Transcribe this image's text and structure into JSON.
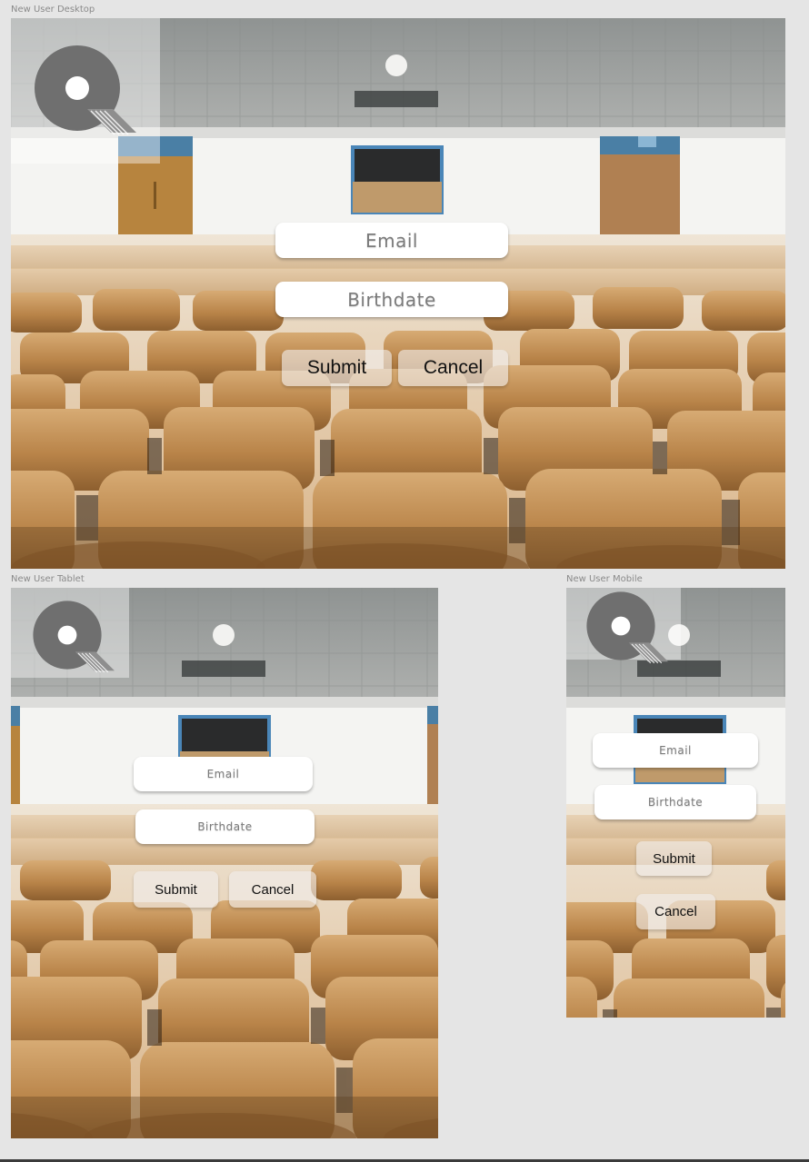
{
  "frames": {
    "desktop": {
      "label": "New User Desktop"
    },
    "tablet": {
      "label": "New User Tablet"
    },
    "mobile": {
      "label": "New User Mobile"
    }
  },
  "form": {
    "email_placeholder": "Email",
    "birthdate_placeholder": "Birthdate",
    "submit_label": "Submit",
    "cancel_label": "Cancel"
  },
  "icons": {
    "logo": "q-logo-icon"
  },
  "colors": {
    "canvas": "#e5e5e5",
    "logo": "#6f6f6f",
    "chair_wood": "#b8874f",
    "wall": "#f4f4f2",
    "ceiling": "#9c9e9d",
    "field_bg": "#ffffff"
  }
}
